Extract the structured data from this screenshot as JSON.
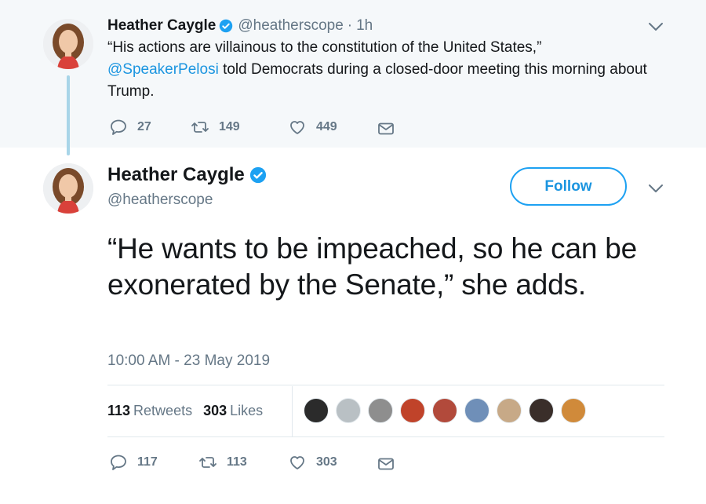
{
  "parent_tweet": {
    "name": "Heather Caygle",
    "handle": "@heatherscope",
    "separator": "·",
    "time": "1h",
    "text_part1": "“His actions are villainous to the constitution of the United States,”",
    "mention": "@SpeakerPelosi",
    "text_part2": " told Democrats during a closed-door meeting this morning about Trump.",
    "actions": {
      "replies": "27",
      "retweets": "149",
      "likes": "449"
    }
  },
  "main_tweet": {
    "name": "Heather Caygle",
    "handle": "@heatherscope",
    "follow_label": "Follow",
    "text": "“He wants to be impeached, so he can be exonerated by the Senate,” she adds.",
    "timestamp": "10:00 AM - 23 May 2019",
    "stats": {
      "retweets_count": "113",
      "retweets_label": "Retweets",
      "likes_count": "303",
      "likes_label": "Likes"
    },
    "likers": [
      {
        "color": "#2b2b2b"
      },
      {
        "color": "#b9c0c4"
      },
      {
        "color": "#8e8e8e"
      },
      {
        "color": "#c0432a"
      },
      {
        "color": "#b24a3b"
      },
      {
        "color": "#6f8fb8"
      },
      {
        "color": "#c7a987"
      },
      {
        "color": "#3a2e2a"
      },
      {
        "color": "#d08a3a"
      }
    ],
    "actions": {
      "replies": "117",
      "retweets": "113",
      "likes": "303"
    }
  },
  "icons": {
    "verified": "verified-badge-icon",
    "chevron": "chevron-down-icon",
    "reply": "reply-icon",
    "retweet": "retweet-icon",
    "like": "heart-icon",
    "dm": "envelope-icon"
  },
  "colors": {
    "accent": "#1da1f2",
    "link": "#1b95e0",
    "muted": "#657786",
    "parent_bg": "#f5f8fa",
    "thread_line": "#a8d5e8"
  }
}
